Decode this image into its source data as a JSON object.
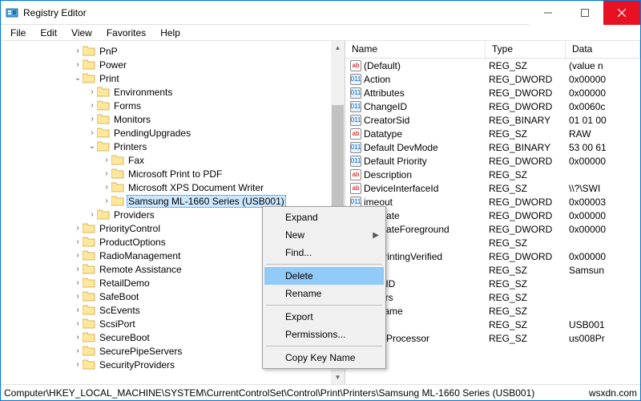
{
  "window": {
    "title": "Registry Editor"
  },
  "menubar": [
    "File",
    "Edit",
    "View",
    "Favorites",
    "Help"
  ],
  "tree": [
    {
      "d": 5,
      "e": ">",
      "n": "PnP"
    },
    {
      "d": 5,
      "e": ">",
      "n": "Power"
    },
    {
      "d": 5,
      "e": "v",
      "n": "Print"
    },
    {
      "d": 6,
      "e": ">",
      "n": "Environments"
    },
    {
      "d": 6,
      "e": ">",
      "n": "Forms"
    },
    {
      "d": 6,
      "e": ">",
      "n": "Monitors"
    },
    {
      "d": 6,
      "e": ">",
      "n": "PendingUpgrades"
    },
    {
      "d": 6,
      "e": "v",
      "n": "Printers"
    },
    {
      "d": 7,
      "e": ">",
      "n": "Fax"
    },
    {
      "d": 7,
      "e": ">",
      "n": "Microsoft Print to PDF"
    },
    {
      "d": 7,
      "e": ">",
      "n": "Microsoft XPS Document Writer"
    },
    {
      "d": 7,
      "e": ">",
      "n": "Samsung ML-1660 Series (USB001)",
      "sel": true
    },
    {
      "d": 6,
      "e": ">",
      "n": "Providers"
    },
    {
      "d": 5,
      "e": ">",
      "n": "PriorityControl"
    },
    {
      "d": 5,
      "e": ">",
      "n": "ProductOptions"
    },
    {
      "d": 5,
      "e": ">",
      "n": "RadioManagement"
    },
    {
      "d": 5,
      "e": ">",
      "n": "Remote Assistance"
    },
    {
      "d": 5,
      "e": ">",
      "n": "RetailDemo"
    },
    {
      "d": 5,
      "e": ">",
      "n": "SafeBoot"
    },
    {
      "d": 5,
      "e": ">",
      "n": "ScEvents"
    },
    {
      "d": 5,
      "e": ">",
      "n": "ScsiPort"
    },
    {
      "d": 5,
      "e": ">",
      "n": "SecureBoot"
    },
    {
      "d": 5,
      "e": ">",
      "n": "SecurePipeServers"
    },
    {
      "d": 5,
      "e": ">",
      "n": "SecurityProviders"
    }
  ],
  "columns": {
    "name": "Name",
    "type": "Type",
    "data": "Data"
  },
  "values": [
    {
      "i": "str",
      "n": "(Default)",
      "t": "REG_SZ",
      "d": "(value n"
    },
    {
      "i": "bin",
      "n": "Action",
      "t": "REG_DWORD",
      "d": "0x00000"
    },
    {
      "i": "bin",
      "n": "Attributes",
      "t": "REG_DWORD",
      "d": "0x00000"
    },
    {
      "i": "bin",
      "n": "ChangeID",
      "t": "REG_DWORD",
      "d": "0x0060c"
    },
    {
      "i": "bin",
      "n": "CreatorSid",
      "t": "REG_BINARY",
      "d": "01 01 00"
    },
    {
      "i": "str",
      "n": "Datatype",
      "t": "REG_SZ",
      "d": "RAW"
    },
    {
      "i": "bin",
      "n": "Default DevMode",
      "t": "REG_BINARY",
      "d": "53 00 61"
    },
    {
      "i": "bin",
      "n": "Default Priority",
      "t": "REG_DWORD",
      "d": "0x00000"
    },
    {
      "i": "str",
      "n": "Description",
      "t": "REG_SZ",
      "d": ""
    },
    {
      "i": "str",
      "n": "DeviceInterfaceId",
      "t": "REG_SZ",
      "d": "\\\\?\\SWI"
    },
    {
      "i": "bin",
      "n": "imeout",
      "t": "REG_DWORD",
      "d": "0x00003"
    },
    {
      "i": "bin",
      "n": "yUpdate",
      "t": "REG_DWORD",
      "d": "0x00000"
    },
    {
      "i": "bin",
      "n": "yUpdateForeground",
      "t": "REG_DWORD",
      "d": "0x00000"
    },
    {
      "i": "str",
      "n": "tion",
      "t": "REG_SZ",
      "d": ""
    },
    {
      "i": "bin",
      "n": "ernPrintingVerified",
      "t": "REG_DWORD",
      "d": "0x00000"
    },
    {
      "i": "str",
      "n": "e",
      "t": "REG_SZ",
      "d": "Samsun"
    },
    {
      "i": "str",
      "n": "ctGUID",
      "t": "REG_SZ",
      "d": ""
    },
    {
      "i": "str",
      "n": "meters",
      "t": "REG_SZ",
      "d": ""
    },
    {
      "i": "str",
      "n": "serName",
      "t": "REG_SZ",
      "d": ""
    },
    {
      "i": "str",
      "n": "",
      "t": "REG_SZ",
      "d": "USB001"
    },
    {
      "i": "str",
      "n": "Print Processor",
      "t": "REG_SZ",
      "d": "us008Pr"
    }
  ],
  "context": {
    "items": [
      {
        "l": "Expand"
      },
      {
        "l": "New",
        "sub": true
      },
      {
        "l": "Find..."
      },
      {
        "sep": true
      },
      {
        "l": "Delete",
        "hl": true
      },
      {
        "l": "Rename"
      },
      {
        "sep": true
      },
      {
        "l": "Export"
      },
      {
        "l": "Permissions..."
      },
      {
        "sep": true
      },
      {
        "l": "Copy Key Name"
      }
    ]
  },
  "status": {
    "path": "Computer\\HKEY_LOCAL_MACHINE\\SYSTEM\\CurrentControlSet\\Control\\Print\\Printers\\Samsung ML-1660 Series (USB001)",
    "right": "wsxdn.com"
  }
}
